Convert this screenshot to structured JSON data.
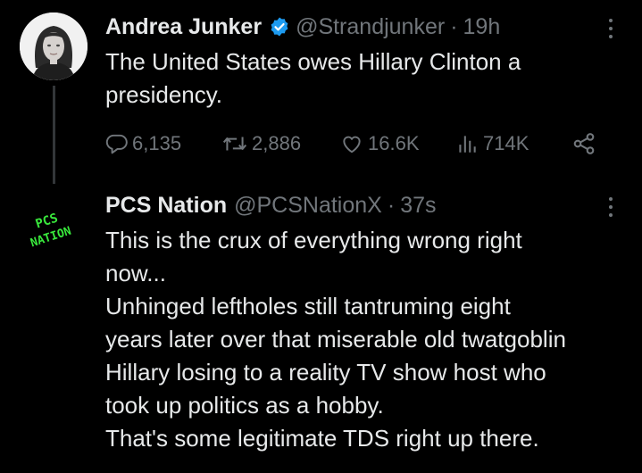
{
  "tweets": [
    {
      "author": "Andrea Junker",
      "verified": true,
      "handle": "@Strandjunker",
      "separator": "·",
      "time": "19h",
      "lines": [
        "The United States owes Hillary Clinton a",
        "presidency."
      ],
      "stats": {
        "replies": "6,135",
        "reposts": "2,886",
        "likes": "16.6K",
        "views": "714K"
      }
    },
    {
      "author": "PCS Nation",
      "handle": "@PCSNationX",
      "separator": "·",
      "time": "37s",
      "avatar_text": "PCS NATION",
      "lines": [
        "This is the crux of everything wrong right",
        "now...",
        "Unhinged leftholes still tantruming eight",
        "years later over that miserable old twatgoblin",
        "Hillary losing to a reality TV show host who",
        "took up politics as a hobby.",
        "That's some legitimate TDS right up there."
      ]
    }
  ],
  "colors": {
    "background": "#000000",
    "text": "#e7e9ea",
    "secondary": "#71767b",
    "verified": "#1d9bf0",
    "avatar_logo": "#39e83c"
  },
  "icons": {
    "verified": "verified-badge-icon",
    "reply": "reply-icon",
    "repost": "repost-icon",
    "like": "heart-icon",
    "views": "views-icon",
    "share": "share-icon",
    "menu": "more-options-icon"
  }
}
